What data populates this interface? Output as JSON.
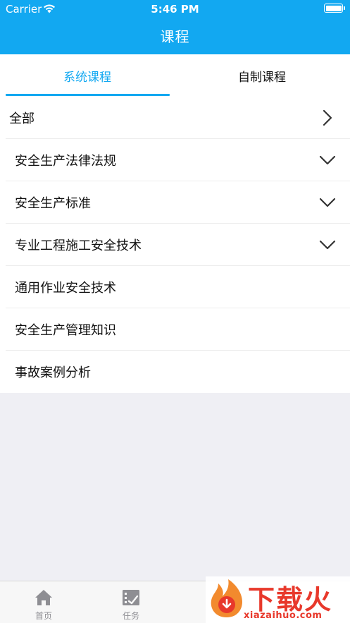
{
  "status_bar": {
    "carrier": "Carrier",
    "time": "5:46 PM"
  },
  "nav": {
    "title": "课程"
  },
  "tabs": [
    {
      "label": "系统课程",
      "active": true
    },
    {
      "label": "自制课程",
      "active": false
    }
  ],
  "list": {
    "all_label": "全部",
    "items": [
      {
        "label": "安全生产法律法规",
        "expandable": true
      },
      {
        "label": "安全生产标准",
        "expandable": true
      },
      {
        "label": "专业工程施工安全技术",
        "expandable": true
      },
      {
        "label": "通用作业安全技术",
        "expandable": false
      },
      {
        "label": "安全生产管理知识",
        "expandable": false
      },
      {
        "label": "事故案例分析",
        "expandable": false
      }
    ]
  },
  "tabbar": [
    {
      "label": "首页",
      "icon": "home-icon"
    },
    {
      "label": "任务",
      "icon": "task-icon"
    }
  ],
  "watermark": {
    "text": "下载火",
    "site": "xiazaihuo.com"
  },
  "colors": {
    "accent": "#12a8f1",
    "background": "#efeff4",
    "tabbar_inactive": "#8e8e93",
    "watermark": "#e8382b"
  }
}
